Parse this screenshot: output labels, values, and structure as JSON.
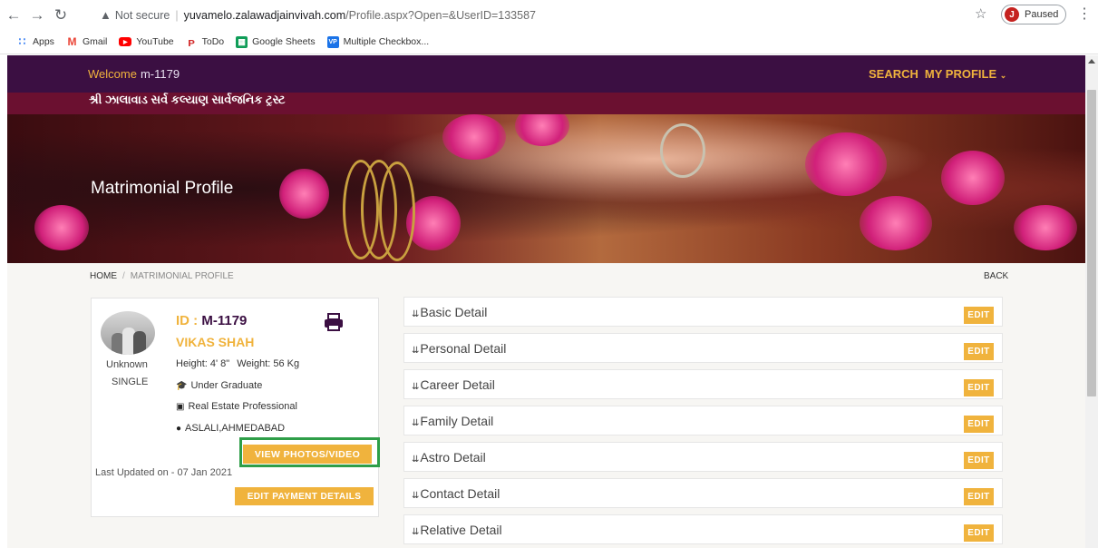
{
  "browser": {
    "not_secure": "Not secure",
    "url_host": "yuvamelo.zalawadjainvivah.com",
    "url_path": "/Profile.aspx?Open=&UserID=133587",
    "profile_initial": "J",
    "profile_status": "Paused",
    "bookmarks": [
      {
        "label": "Apps",
        "icon": "apps-grid-icon",
        "color": "#4285f4"
      },
      {
        "label": "Gmail",
        "icon": "gmail-icon",
        "color": "#ea4335"
      },
      {
        "label": "YouTube",
        "icon": "youtube-icon",
        "color": "#ff0000"
      },
      {
        "label": "ToDo",
        "icon": "todo-icon",
        "color": "#d32f2f"
      },
      {
        "label": "Google Sheets",
        "icon": "sheets-icon",
        "color": "#0f9d58"
      },
      {
        "label": "Multiple Checkbox...",
        "icon": "vp-icon",
        "color": "#1a73e8"
      }
    ]
  },
  "site": {
    "welcome_label": "Welcome",
    "welcome_user": "m-1179",
    "menu": {
      "search": "SEARCH",
      "my_profile": "MY PROFILE"
    },
    "gujarati_banner": "શ્રી ઝાલાવાડ સર્વ કલ્યાણ સાર્વજનિક ટ્રસ્ટ",
    "hero_title": "Matrimonial Profile",
    "breadcrumb": {
      "home": "HOME",
      "current": "MATRIMONIAL PROFILE",
      "back": "BACK"
    }
  },
  "profile": {
    "id_label": "ID :",
    "id_value": "M-1179",
    "name": "VIKAS SHAH",
    "unknown": "Unknown",
    "status": "SINGLE",
    "height": "Height: 4' 8\"",
    "weight": "Weight: 56 Kg",
    "education": "Under Graduate",
    "occupation": "Real Estate Professional",
    "location": "ASLALI,AHMEDABAD",
    "view_photos": "VIEW PHOTOS/VIDEO",
    "last_updated": "Last Updated on - 07 Jan 2021",
    "edit_payment": "EDIT PAYMENT DETAILS"
  },
  "sections": {
    "edit_label": "EDIT",
    "items": [
      "Basic Detail",
      "Personal Detail",
      "Career Detail",
      "Family Detail",
      "Astro Detail",
      "Contact Detail",
      "Relative Detail"
    ]
  },
  "colors": {
    "nav_bg": "#3b0f42",
    "accent": "#f0b33d",
    "banner": "#6b1030",
    "highlight": "#2e9e48"
  }
}
